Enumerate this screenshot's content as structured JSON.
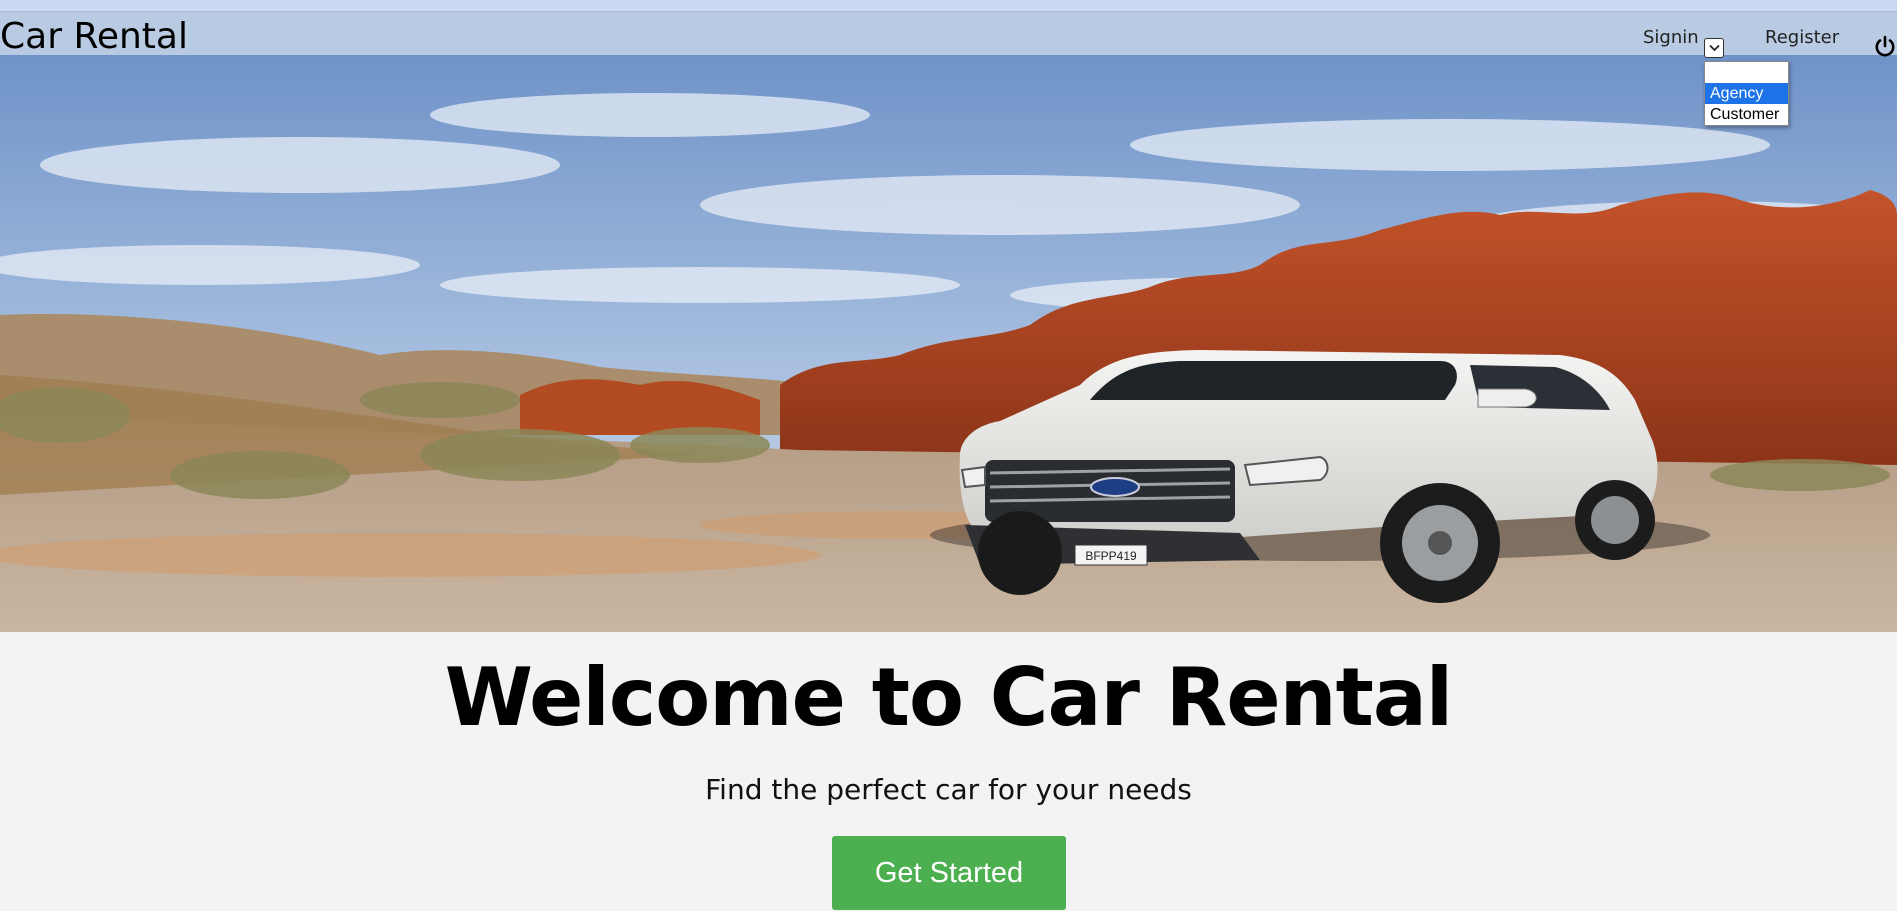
{
  "nav": {
    "brand": "Car Rental",
    "signin_label": "Signin",
    "register_label": "Register",
    "signin_options": [
      "",
      "Agency",
      "Customer"
    ],
    "signin_highlighted": "Agency"
  },
  "hero": {
    "image": "white SUV on gravel road in red rock desert",
    "plate_text": "BFPP419"
  },
  "main": {
    "headline": "Welcome to Car Rental",
    "subtitle": "Find the perfect car for your needs",
    "cta_label": "Get Started"
  },
  "colors": {
    "navbar": "#b8cbe2",
    "cta": "#4caf50",
    "page_bg": "#f3f3f3",
    "highlight": "#1e73e8"
  },
  "icons": [
    "chevron-down-icon",
    "power-icon"
  ]
}
